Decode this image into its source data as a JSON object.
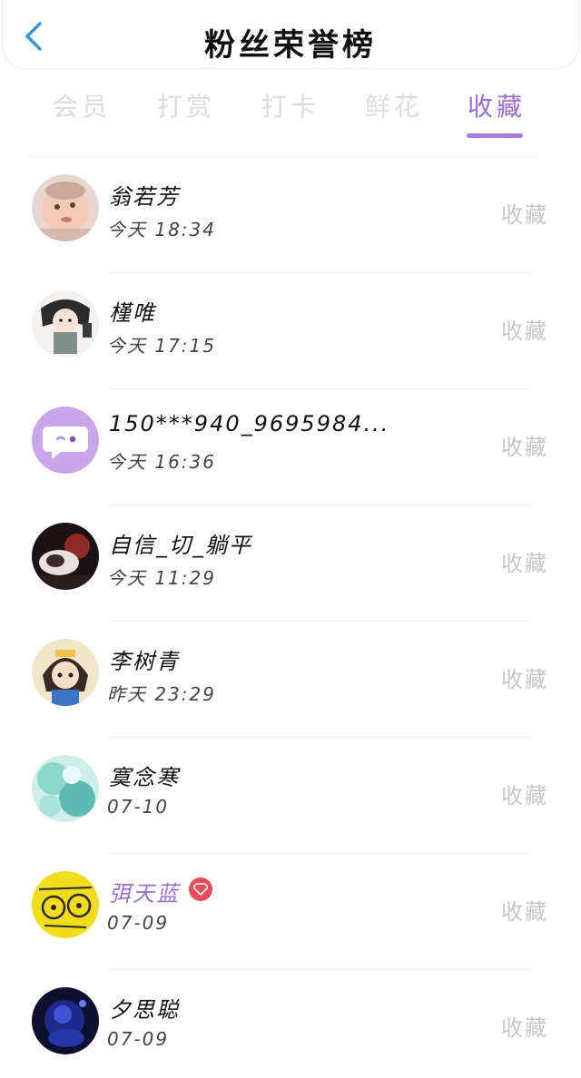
{
  "header": {
    "title": "粉丝荣誉榜"
  },
  "tabs": [
    {
      "label": "会员"
    },
    {
      "label": "打赏"
    },
    {
      "label": "打卡"
    },
    {
      "label": "鲜花"
    },
    {
      "label": "收藏"
    }
  ],
  "active_tab": "收藏",
  "users": [
    {
      "name": "翁若芳",
      "time": "今天 18:34",
      "action": "收藏"
    },
    {
      "name": "槿唯",
      "time": "今天 17:15",
      "action": "收藏"
    },
    {
      "name": "150***940_9695984...",
      "time": "今天 16:36",
      "action": "收藏"
    },
    {
      "name": "自信_切_躺平",
      "time": "今天 11:29",
      "action": "收藏"
    },
    {
      "name": "李树青",
      "time": "昨天 23:29",
      "action": "收藏"
    },
    {
      "name": "寞念寒",
      "time": "07-10",
      "action": "收藏"
    },
    {
      "name": "弭天蓝",
      "time": "07-09",
      "action": "收藏",
      "vip": true
    },
    {
      "name": "夕思聪",
      "time": "07-09",
      "action": "收藏"
    }
  ],
  "colors": {
    "accent": "#9b6bd6",
    "back_arrow": "#2f9ae0",
    "vip_badge": "#ea4a5a",
    "inactive_tab": "#dcdcdc",
    "action_text": "#c8c8c8"
  },
  "icons": {
    "back": "chevron-left-icon",
    "vip": "diamond-icon",
    "default_avatar": "chat-bubble-icon"
  }
}
